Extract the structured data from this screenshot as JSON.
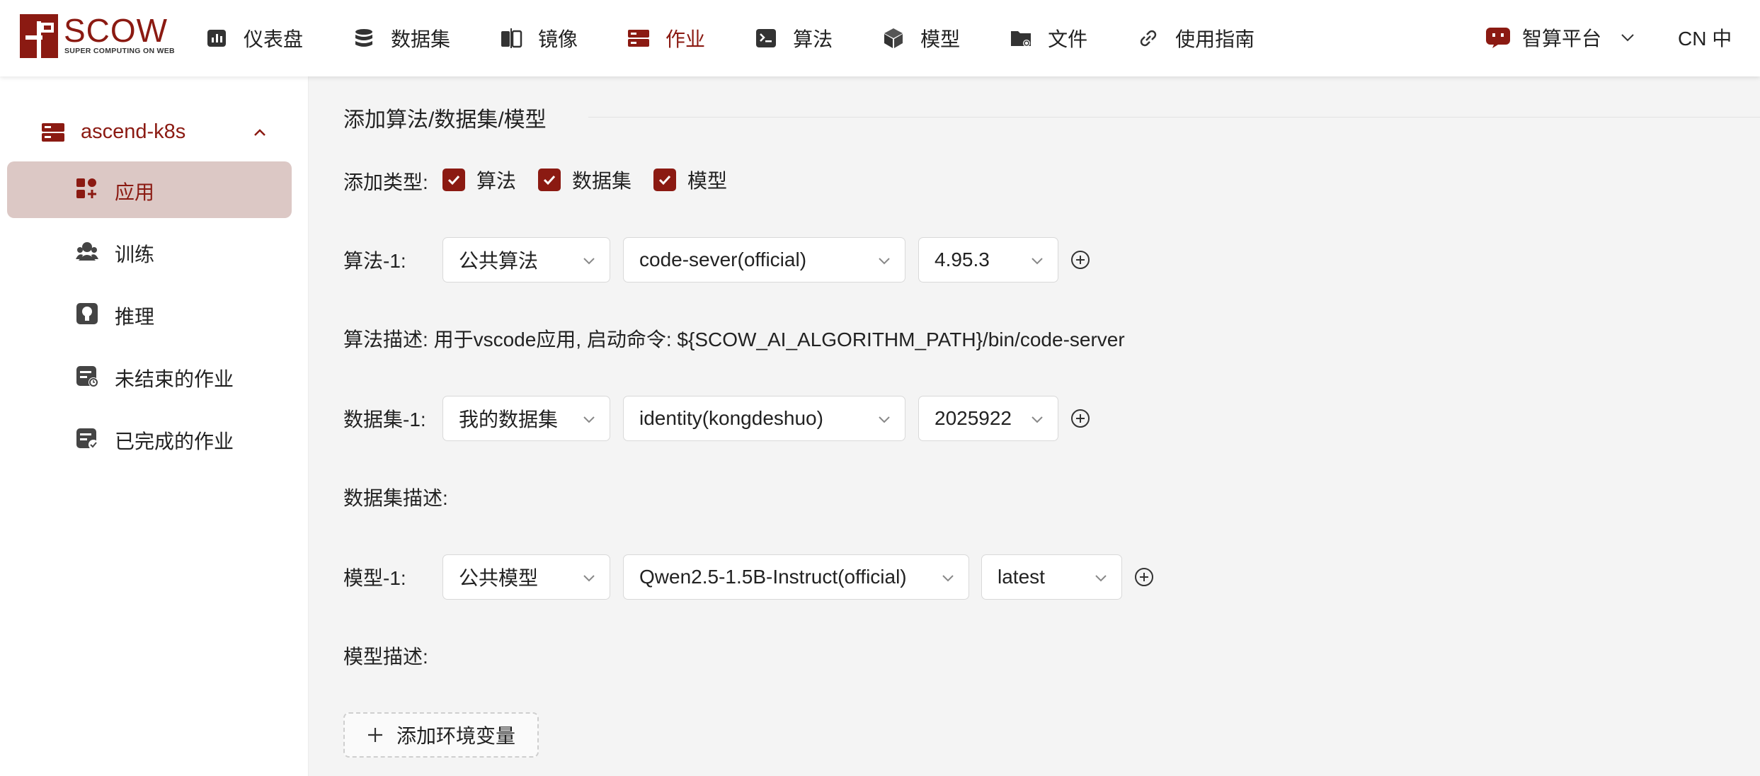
{
  "logo": {
    "text": "SCOW",
    "subtitle": "SUPER COMPUTING ON WEB"
  },
  "nav": [
    {
      "label": "仪表盘",
      "icon": "dashboard-icon"
    },
    {
      "label": "数据集",
      "icon": "database-icon"
    },
    {
      "label": "镜像",
      "icon": "mirror-icon"
    },
    {
      "label": "作业",
      "icon": "server-icon",
      "active": true
    },
    {
      "label": "算法",
      "icon": "terminal-icon"
    },
    {
      "label": "模型",
      "icon": "cube-icon"
    },
    {
      "label": "文件",
      "icon": "folder-icon"
    },
    {
      "label": "使用指南",
      "icon": "link-icon"
    }
  ],
  "platform": {
    "label": "智算平台"
  },
  "lang": {
    "label": "CN 中"
  },
  "sidebar": {
    "cluster": "ascend-k8s",
    "items": [
      {
        "label": "应用",
        "icon": "apps-icon",
        "active": true
      },
      {
        "label": "训练",
        "icon": "team-icon"
      },
      {
        "label": "推理",
        "icon": "bulb-icon"
      },
      {
        "label": "未结束的作业",
        "icon": "running-job-icon"
      },
      {
        "label": "已完成的作业",
        "icon": "finished-job-icon"
      }
    ]
  },
  "form": {
    "section_title": "添加算法/数据集/模型",
    "add_type_label": "添加类型:",
    "add_types": [
      "算法",
      "数据集",
      "模型"
    ],
    "algorithm": {
      "label": "算法-1:",
      "source": "公共算法",
      "name": "code-sever(official)",
      "version": "4.95.3",
      "desc_label": "算法描述:",
      "desc": "用于vscode应用, 启动命令: ${SCOW_AI_ALGORITHM_PATH}/bin/code-server"
    },
    "dataset": {
      "label": "数据集-1:",
      "source": "我的数据集",
      "name": "identity(kongdeshuo)",
      "version": "2025922",
      "desc_label": "数据集描述:"
    },
    "model": {
      "label": "模型-1:",
      "source": "公共模型",
      "name": "Qwen2.5-1.5B-Instruct(official)",
      "version": "latest",
      "desc_label": "模型描述:"
    },
    "add_env_label": "添加环境变量"
  },
  "colors": {
    "brand": "#8b1a12",
    "active_bg": "#dcc8c5",
    "main_bg": "#f4f4f4"
  }
}
